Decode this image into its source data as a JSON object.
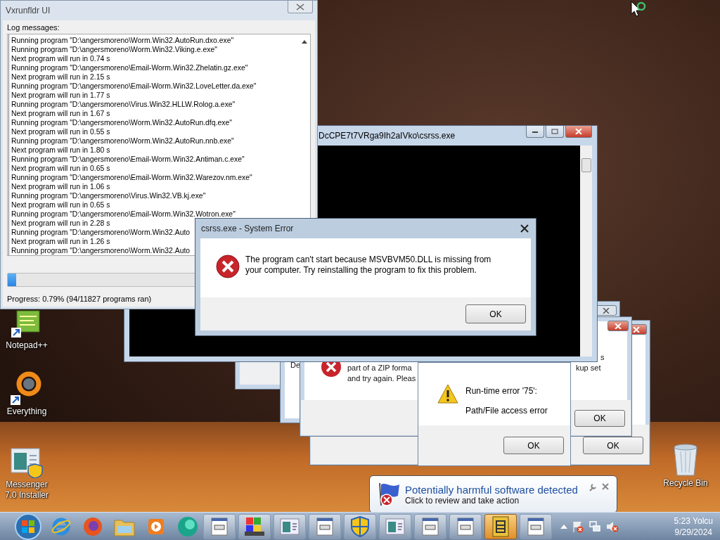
{
  "desktop_icons": [
    {
      "label": "Notepad++",
      "kind": "notepad"
    },
    {
      "label": "Everything",
      "kind": "everything"
    },
    {
      "label": "Messenger 7.0 Installer",
      "kind": "installer"
    },
    {
      "label": "Recycle Bin",
      "kind": "recycle"
    }
  ],
  "log_window": {
    "title": "Vxrunfldr UI",
    "log_label": "Log messages:",
    "log_lines": [
      "Running program \"D:\\angersmoreno\\Worm.Win32.AutoRun.dxo.exe\"",
      "Running program \"D:\\angersmoreno\\Worm.Win32.Viking.e.exe\"",
      "Next program will run in 0.74 s",
      "Running program \"D:\\angersmoreno\\Email-Worm.Win32.Zhelatin.gz.exe\"",
      "Next program will run in 2.15 s",
      "Running program \"D:\\angersmoreno\\Email-Worm.Win32.LoveLetter.da.exe\"",
      "Next program will run in 1.77 s",
      "Running program \"D:\\angersmoreno\\Virus.Win32.HLLW.Rolog.a.exe\"",
      "Next program will run in 1.67 s",
      "Running program \"D:\\angersmoreno\\Worm.Win32.AutoRun.dfq.exe\"",
      "Next program will run in 0.55 s",
      "Running program \"D:\\angersmoreno\\Worm.Win32.AutoRun.nnb.exe\"",
      "Next program will run in 1.80 s",
      "Running program \"D:\\angersmoreno\\Email-Worm.Win32.Antiman.c.exe\"",
      "Next program will run in 0.65 s",
      "Running program \"D:\\angersmoreno\\Email-Worm.Win32.Warezov.nm.exe\"",
      "Next program will run in 1.06 s",
      "Running program \"D:\\angersmoreno\\Virus.Win32.VB.kj.exe\"",
      "Next program will run in 0.65 s",
      "Running program \"D:\\angersmoreno\\Email-Worm.Win32.Wotron.exe\"",
      "Next program will run in 2.28 s",
      "Running program \"D:\\angersmoreno\\Worm.Win32.Auto",
      "Next program will run in 1.26 s",
      "Running program \"D:\\angersmoreno\\Worm.Win32.Auto"
    ],
    "progress": {
      "level": 0.0079
    },
    "progress_text": "Progress: 0.79% (94/11827 programs ran)"
  },
  "console_window": {
    "title": "DcCPE7t7VRga9Ih2aIVko\\csrss.exe"
  },
  "covered_dialog": {
    "fragment": "De"
  },
  "back_dialog": {
    "button": "OK"
  },
  "zip_error_dialog": {
    "fragment_top": "s",
    "line_2_left": "part of a ZIP forma",
    "line_2_right": "kup set",
    "line_3_left": "and try again. Pleas",
    "button": "OK"
  },
  "runtime_error": {
    "heading": "Run-time error '75':",
    "message": "Path/File access error",
    "button": "OK"
  },
  "system_error": {
    "title": "csrss.exe - System Error",
    "message": "The program can't start because MSVBVM50.DLL is missing from your computer. Try reinstalling the program to fix this problem.",
    "button": "OK"
  },
  "notification": {
    "title": "Potentially harmful software detected",
    "subtitle": "Click to review and take action"
  },
  "taskbar": {
    "pinned": [
      {
        "kind": "ie"
      },
      {
        "kind": "firefox"
      },
      {
        "kind": "folder"
      },
      {
        "kind": "media"
      },
      {
        "kind": "orb"
      }
    ],
    "buttons": [
      {
        "kind": "exe",
        "selected": false
      },
      {
        "kind": "setup",
        "selected": false
      },
      {
        "kind": "window",
        "selected": false
      },
      {
        "kind": "exe",
        "selected": false
      },
      {
        "kind": "shield",
        "selected": false
      },
      {
        "kind": "window",
        "selected": false
      },
      {
        "kind": "exe",
        "selected": false
      },
      {
        "kind": "exe",
        "selected": false
      },
      {
        "kind": "archive",
        "selected": true
      },
      {
        "kind": "exe",
        "selected": false
      }
    ],
    "clock": {
      "time": "5:23 Yolcu",
      "date": "9/29/2024"
    }
  }
}
